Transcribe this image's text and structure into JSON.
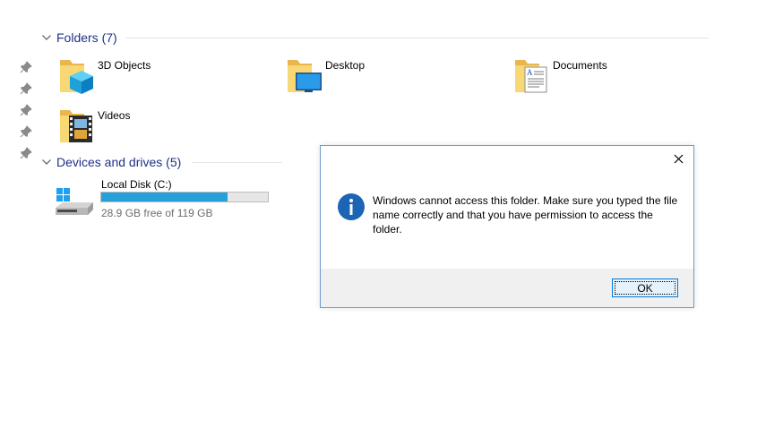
{
  "quick_access": {
    "pins": [
      "pin-icon",
      "pin-icon",
      "pin-icon",
      "pin-icon",
      "pin-icon"
    ]
  },
  "folders": {
    "header": "Folders (7)",
    "items": [
      {
        "label": "3D Objects",
        "icon": "3d-objects-folder-icon"
      },
      {
        "label": "Desktop",
        "icon": "desktop-folder-icon"
      },
      {
        "label": "Documents",
        "icon": "documents-folder-icon"
      },
      {
        "label": "Videos",
        "icon": "videos-folder-icon"
      }
    ]
  },
  "devices": {
    "header": "Devices and drives (5)",
    "drives": [
      {
        "name": "Local Disk (C:)",
        "free_text": "28.9 GB free of 119 GB",
        "used_fraction": 0.757,
        "icon": "local-disk-icon"
      }
    ]
  },
  "dialog": {
    "message": "Windows cannot access this folder. Make sure you typed the file name correctly and that you have permission to access the folder.",
    "ok_label": "OK",
    "icon": "info-icon"
  },
  "colors": {
    "header_text": "#1e3287",
    "drive_fill": "#26a0da",
    "dialog_border": "#6b9bd1",
    "info_blue": "#1c64b4"
  }
}
